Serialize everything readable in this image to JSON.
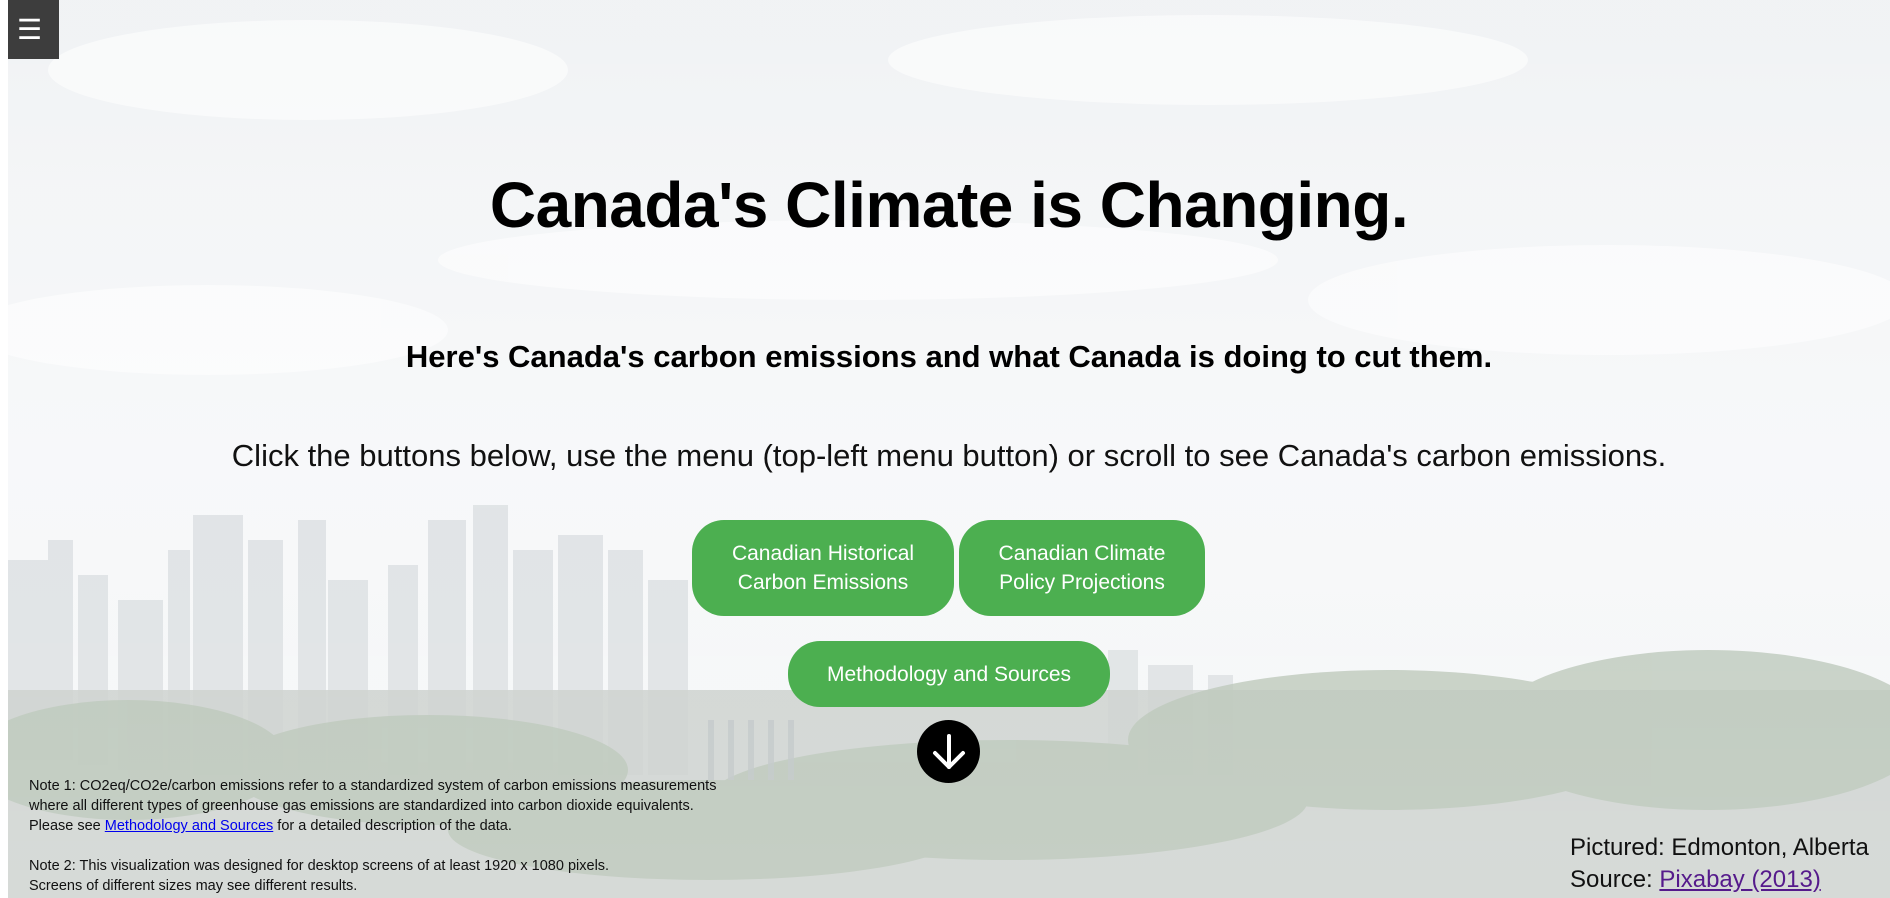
{
  "menu": {
    "icon": "hamburger-icon",
    "glyph": "☰"
  },
  "hero": {
    "title": "Canada's Climate is Changing.",
    "subtitle": "Here's Canada's carbon emissions and what Canada is doing to cut them.",
    "instructions": "Click the buttons below, use the menu (top-left menu button) or scroll to see Canada's carbon emissions."
  },
  "buttons": {
    "historical": "Canadian Historical\nCarbon Emissions",
    "policy": "Canadian Climate\nPolicy Projections",
    "methodology": "Methodology and Sources"
  },
  "scroll": {
    "icon": "arrow-down-icon"
  },
  "notes": {
    "note1_line1": "Note 1: CO2eq/CO2e/carbon emissions refer to a standardized system of carbon emissions measurements",
    "note1_line2": "where all different types of greenhouse gas emissions are standardized into carbon dioxide equivalents.",
    "note1_line3_before": "Please see ",
    "note1_link": "Methodology and Sources",
    "note1_line3_after": " for a detailed description of the data.",
    "note2_line1": "Note 2: This visualization was designed for desktop screens of at least 1920 x 1080 pixels.",
    "note2_line2": "Screens of different sizes may see different results."
  },
  "credits": {
    "pictured": "Pictured: Edmonton, Alberta",
    "source_label": "Source: ",
    "source_link": "Pixabay (2013)"
  },
  "colors": {
    "button_green": "#4caf50",
    "menu_bg": "#3d3d3d",
    "link_blue": "#0000ee",
    "link_visited": "#551a8b"
  }
}
